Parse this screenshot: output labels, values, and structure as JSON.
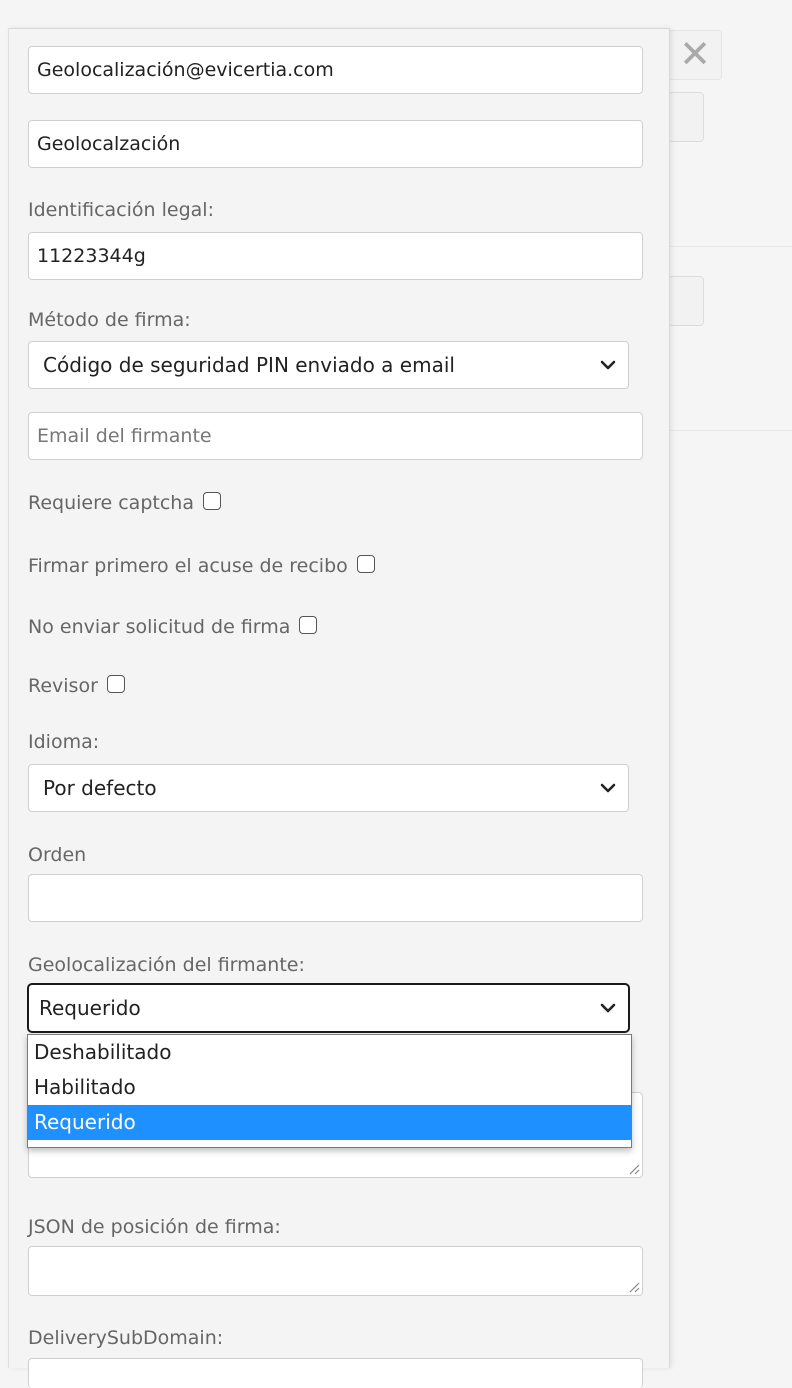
{
  "background": {
    "close_glyph": "✕"
  },
  "form": {
    "email_value": "Geolocalización@evicertia.com",
    "name_value": "Geolocalzación",
    "legal_id_label": "Identificación legal:",
    "legal_id_value": "11223344g",
    "sign_method_label": "Método de firma:",
    "sign_method_value": "Código de seguridad PIN enviado a email",
    "signer_email_placeholder": "Email del firmante",
    "captcha_label": "Requiere captcha",
    "ack_first_label": "Firmar primero el acuse de recibo",
    "no_request_label": "No enviar solicitud de firma",
    "reviewer_label": "Revisor",
    "language_label": "Idioma:",
    "language_value": "Por defecto",
    "order_label": "Orden",
    "order_value": "",
    "geo_label": "Geolocalización del firmante:",
    "geo_value": "Requerido",
    "geo_options": [
      "Deshabilitado",
      "Habilitado",
      "Requerido"
    ],
    "json_position_label": "JSON de posición de firma:",
    "delivery_subdomain_label": "DeliverySubDomain:"
  },
  "colors": {
    "highlight": "#1e90ff"
  }
}
